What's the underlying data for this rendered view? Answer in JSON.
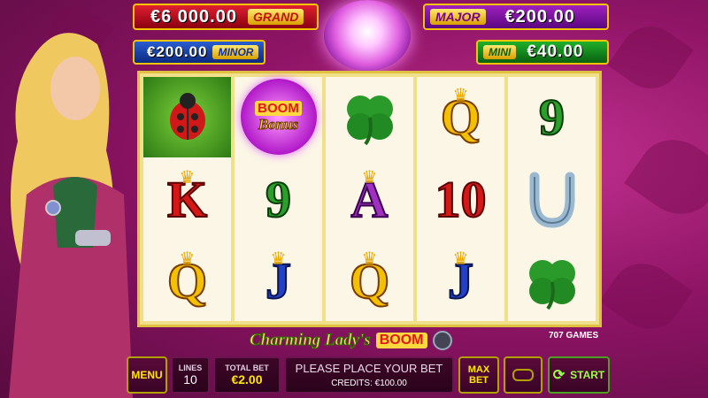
{
  "jackpots": {
    "grand": {
      "amount": "€6 000.00",
      "label": "GRAND"
    },
    "minor": {
      "amount": "€200.00",
      "label": "MINOR"
    },
    "major": {
      "amount": "€200.00",
      "label": "MAJOR"
    },
    "mini": {
      "amount": "€40.00",
      "label": "MINI"
    }
  },
  "reels": [
    [
      {
        "sym": "ladybug",
        "t": ""
      },
      {
        "sym": "letter",
        "t": "K",
        "c": "red"
      },
      {
        "sym": "letter",
        "t": "Q",
        "c": ""
      }
    ],
    [
      {
        "sym": "boom",
        "t": ""
      },
      {
        "sym": "letter",
        "t": "9",
        "c": "green"
      },
      {
        "sym": "letter",
        "t": "J",
        "c": "blue"
      }
    ],
    [
      {
        "sym": "clover",
        "t": ""
      },
      {
        "sym": "letter",
        "t": "A",
        "c": "purple"
      },
      {
        "sym": "letter",
        "t": "Q",
        "c": ""
      }
    ],
    [
      {
        "sym": "letter",
        "t": "Q",
        "c": ""
      },
      {
        "sym": "letter",
        "t": "10",
        "c": "red"
      },
      {
        "sym": "letter",
        "t": "J",
        "c": "blue"
      }
    ],
    [
      {
        "sym": "letter",
        "t": "9",
        "c": "green"
      },
      {
        "sym": "horseshoe",
        "t": ""
      },
      {
        "sym": "clover",
        "t": ""
      }
    ]
  ],
  "boom_symbol": {
    "top": "BOOM",
    "bottom": "Bonus"
  },
  "logo": {
    "title": "Charming Lady's",
    "boom": "BOOM",
    "studio": "707 GAMES"
  },
  "controls": {
    "menu": "MENU",
    "lines_label": "LINES",
    "lines_value": "10",
    "total_bet_label": "TOTAL BET",
    "total_bet_value": "€2.00",
    "message": "PLEASE PLACE YOUR BET",
    "credits": "CREDITS: €100.00",
    "max_bet": "MAX BET",
    "start": "START"
  },
  "colors": {
    "background": "#8f1466",
    "gold": "#f5c400",
    "start_green": "#9cff4a"
  }
}
